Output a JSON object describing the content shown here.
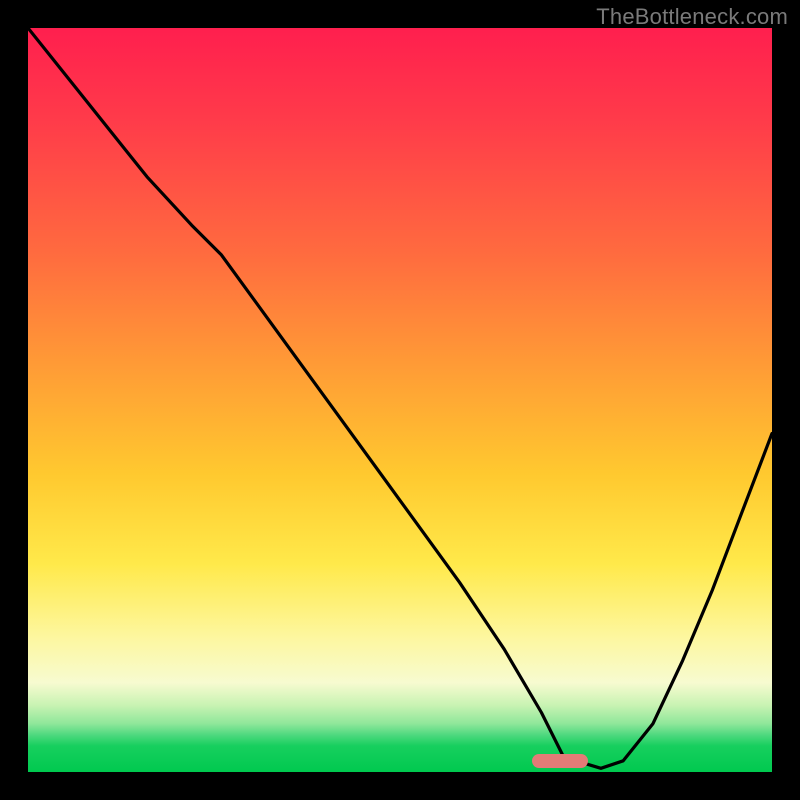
{
  "watermark": "TheBottleneck.com",
  "marker": {
    "color": "#e37b77",
    "x_frac": 0.715,
    "y_frac": 0.985
  },
  "chart_data": {
    "type": "line",
    "title": "",
    "xlabel": "",
    "ylabel": "",
    "xlim": [
      0,
      1
    ],
    "ylim": [
      0,
      1
    ],
    "grid": false,
    "legend": false,
    "background_gradient": [
      "#ff1f4e",
      "#ff6a3f",
      "#ffc92f",
      "#fdf7a0",
      "#00c94f"
    ],
    "series": [
      {
        "name": "curve",
        "color": "#000000",
        "x": [
          0.0,
          0.08,
          0.16,
          0.22,
          0.26,
          0.34,
          0.42,
          0.5,
          0.58,
          0.64,
          0.69,
          0.72,
          0.77,
          0.8,
          0.84,
          0.88,
          0.92,
          0.96,
          1.0
        ],
        "values": [
          1.0,
          0.9,
          0.8,
          0.735,
          0.695,
          0.585,
          0.475,
          0.365,
          0.255,
          0.165,
          0.08,
          0.02,
          0.005,
          0.015,
          0.065,
          0.15,
          0.245,
          0.35,
          0.455
        ]
      }
    ],
    "annotations": [
      {
        "type": "marker",
        "shape": "pill",
        "x": 0.715,
        "y": 0.015,
        "color": "#e37b77"
      }
    ]
  }
}
